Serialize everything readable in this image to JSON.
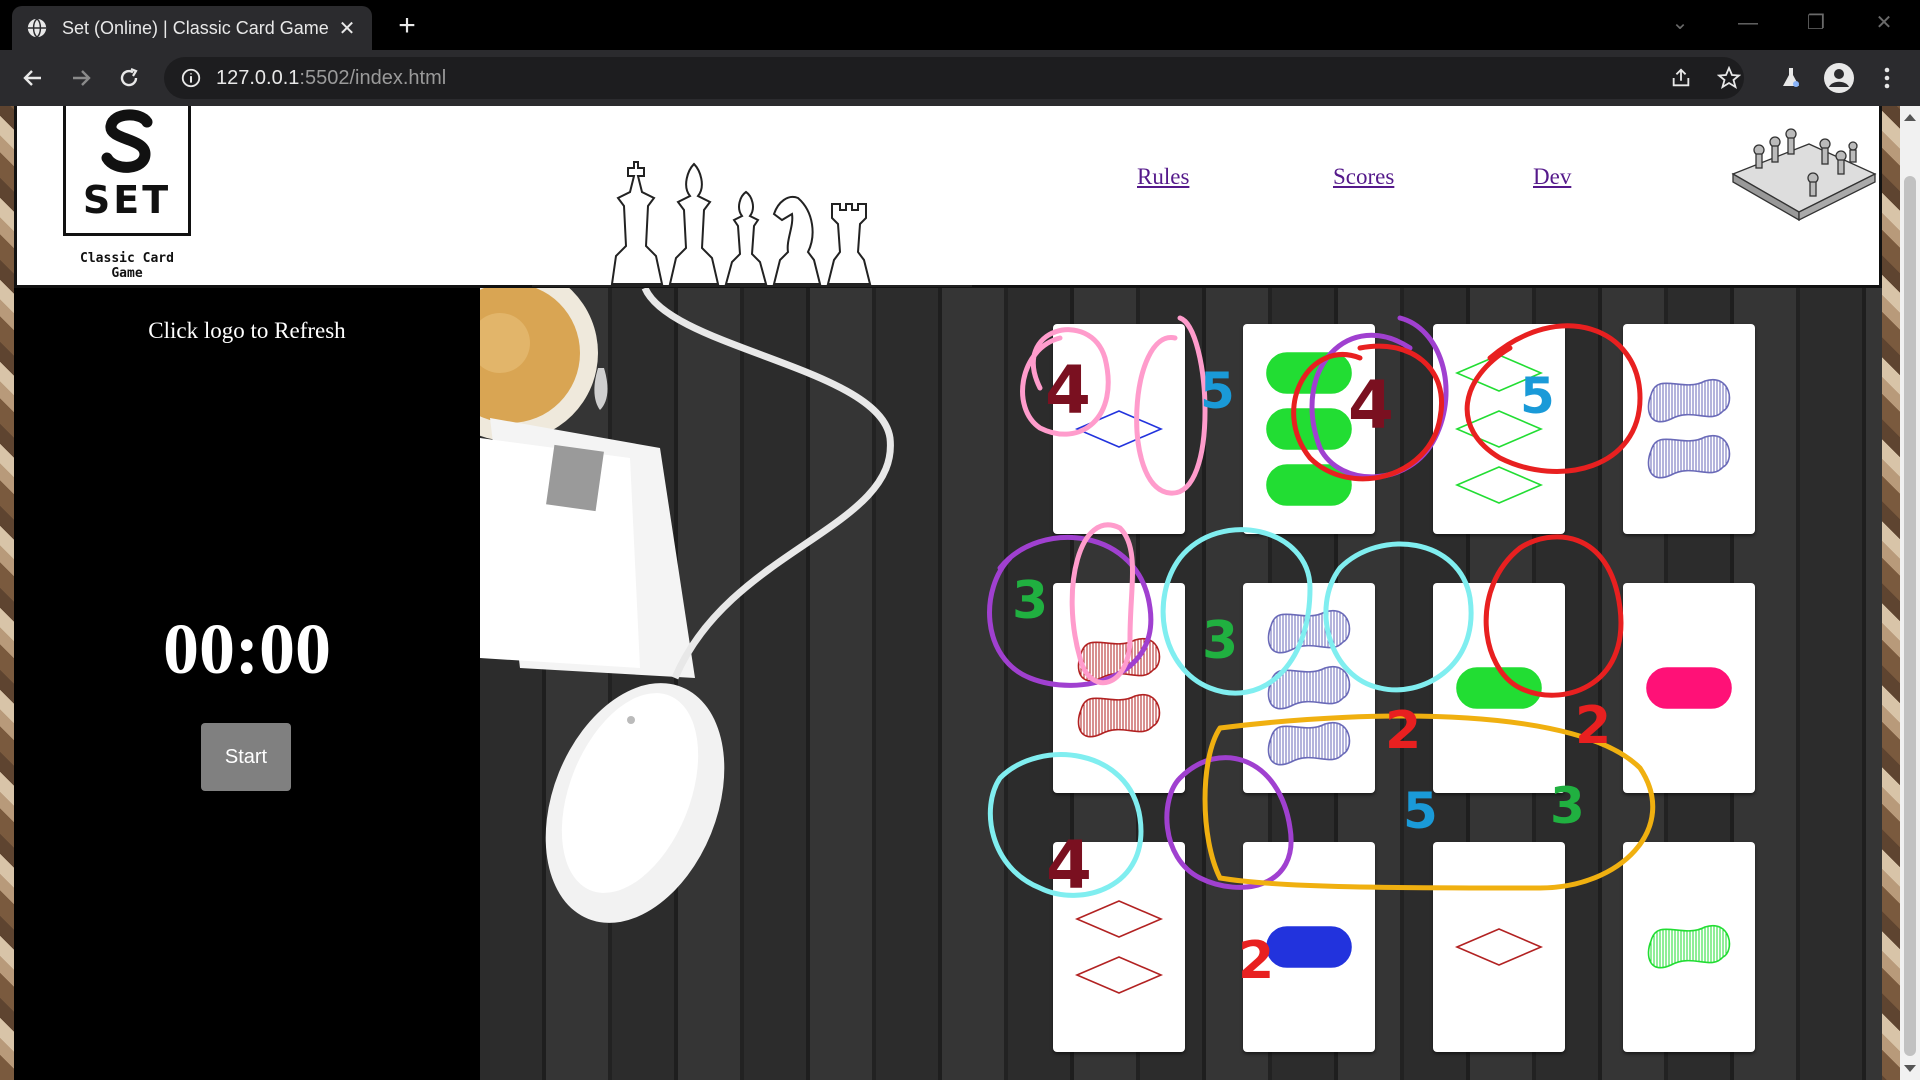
{
  "browser": {
    "tab_title": "Set (Online) | Classic Card Game",
    "url_host": "127.0.0.1",
    "url_path": ":5502/index.html"
  },
  "header": {
    "logo_text": "SET",
    "logo_tagline": "Classic Card Game",
    "nav": [
      {
        "label": "Rules"
      },
      {
        "label": "Scores"
      },
      {
        "label": "Dev"
      }
    ]
  },
  "sidebar": {
    "refresh_text": "Click logo to Refresh",
    "timer": "00:00",
    "start_label": "Start"
  },
  "colors": {
    "red": "#b22222",
    "green": "#22dd33",
    "purple": "#6a6ab8",
    "blue": "#2233dd",
    "pink": "#ff1177",
    "salmon": "#d88888"
  },
  "cards": [
    {
      "row": 1,
      "col": 1,
      "number": 1,
      "shape": "diamond",
      "shading": "outline",
      "color": "blue"
    },
    {
      "row": 1,
      "col": 2,
      "number": 3,
      "shape": "oval",
      "shading": "solid",
      "color": "green"
    },
    {
      "row": 1,
      "col": 3,
      "number": 3,
      "shape": "diamond",
      "shading": "outline",
      "color": "green"
    },
    {
      "row": 1,
      "col": 4,
      "number": 2,
      "shape": "squiggle",
      "shading": "striped",
      "color": "purple"
    },
    {
      "row": 2,
      "col": 1,
      "number": 2,
      "shape": "squiggle",
      "shading": "striped",
      "color": "red"
    },
    {
      "row": 2,
      "col": 2,
      "number": 3,
      "shape": "squiggle",
      "shading": "striped",
      "color": "purple"
    },
    {
      "row": 2,
      "col": 3,
      "number": 1,
      "shape": "oval",
      "shading": "solid",
      "color": "green"
    },
    {
      "row": 2,
      "col": 4,
      "number": 1,
      "shape": "oval",
      "shading": "solid",
      "color": "pink"
    },
    {
      "row": 3,
      "col": 1,
      "number": 2,
      "shape": "diamond",
      "shading": "outline",
      "color": "red"
    },
    {
      "row": 3,
      "col": 2,
      "number": 1,
      "shape": "oval",
      "shading": "solid",
      "color": "blue"
    },
    {
      "row": 3,
      "col": 3,
      "number": 1,
      "shape": "diamond",
      "shading": "outline",
      "color": "red"
    },
    {
      "row": 3,
      "col": 4,
      "number": 1,
      "shape": "squiggle",
      "shading": "striped",
      "color": "green"
    }
  ],
  "annotations": [
    "4",
    "5",
    "4",
    "5",
    "3",
    "3",
    "2",
    "2",
    "4",
    "2",
    "5",
    "3"
  ]
}
